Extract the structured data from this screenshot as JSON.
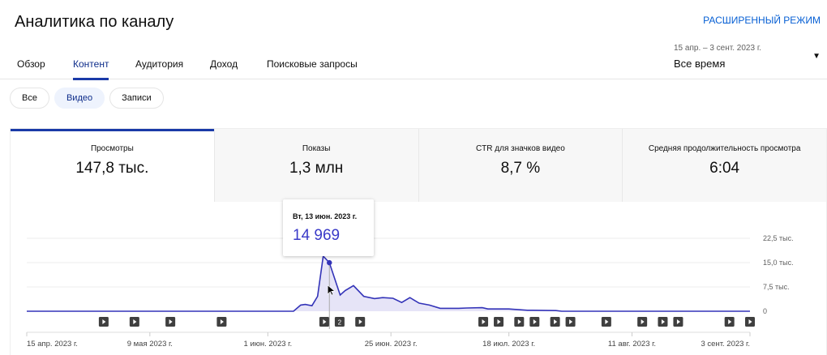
{
  "header": {
    "title": "Аналитика по каналу",
    "advanced_mode": "РАСШИРЕННЫЙ РЕЖИМ"
  },
  "tabs": [
    {
      "label": "Обзор"
    },
    {
      "label": "Контент",
      "active": true
    },
    {
      "label": "Аудитория"
    },
    {
      "label": "Доход"
    },
    {
      "label": "Поисковые запросы"
    }
  ],
  "date_range": {
    "range": "15 апр. – 3 сент. 2023 г.",
    "selected": "Все время"
  },
  "filters": [
    {
      "label": "Все"
    },
    {
      "label": "Видео",
      "active": true
    },
    {
      "label": "Записи"
    }
  ],
  "metrics": [
    {
      "label": "Просмотры",
      "value": "147,8 тыс.",
      "active": true
    },
    {
      "label": "Показы",
      "value": "1,3 млн"
    },
    {
      "label": "CTR для значков видео",
      "value": "8,7 %"
    },
    {
      "label": "Средняя продолжительность просмотра",
      "value": "6:04"
    }
  ],
  "tooltip": {
    "date": "Вт, 13 июн. 2023 г.",
    "value": "14 969"
  },
  "chart_data": {
    "type": "area",
    "title": "Просмотры",
    "x_unit": "days since 15 апр. 2023",
    "xlim": [
      0,
      141
    ],
    "ylim": [
      0,
      22500
    ],
    "y_ticks": [
      {
        "v": 22500,
        "label": "22,5 тыс."
      },
      {
        "v": 15000,
        "label": "15,0 тыс."
      },
      {
        "v": 7500,
        "label": "7,5 тыс."
      },
      {
        "v": 0,
        "label": "0"
      }
    ],
    "x_ticks": [
      {
        "d": 0,
        "label": "15 апр. 2023 г."
      },
      {
        "d": 24,
        "label": "9 мая 2023 г."
      },
      {
        "d": 47,
        "label": "1 июн. 2023 г."
      },
      {
        "d": 71,
        "label": "25 июн. 2023 г."
      },
      {
        "d": 94,
        "label": "18 июл. 2023 г."
      },
      {
        "d": 118,
        "label": "11 авг. 2023 г."
      },
      {
        "d": 141,
        "label": "3 сент. 2023 г."
      }
    ],
    "points": [
      [
        0,
        0
      ],
      [
        52,
        0
      ],
      [
        53.4,
        1900
      ],
      [
        54.3,
        2100
      ],
      [
        55.6,
        1700
      ],
      [
        56.7,
        4600
      ],
      [
        57.8,
        17000
      ],
      [
        59,
        14969
      ],
      [
        61.1,
        5000
      ],
      [
        62.1,
        6400
      ],
      [
        63.7,
        7900
      ],
      [
        65.7,
        4600
      ],
      [
        67.8,
        3900
      ],
      [
        69.4,
        4200
      ],
      [
        71.4,
        4000
      ],
      [
        73.1,
        2700
      ],
      [
        74.7,
        4200
      ],
      [
        76.5,
        2500
      ],
      [
        78.5,
        1900
      ],
      [
        80.6,
        900
      ],
      [
        84.2,
        900
      ],
      [
        85.8,
        1000
      ],
      [
        88.8,
        1100
      ],
      [
        89.9,
        700
      ],
      [
        94,
        700
      ],
      [
        97.6,
        300
      ],
      [
        98.6,
        300
      ],
      [
        103.2,
        200
      ],
      [
        104.3,
        0
      ],
      [
        141,
        0
      ]
    ],
    "highlight_day": 59,
    "video_markers": [
      {
        "d": 15
      },
      {
        "d": 21
      },
      {
        "d": 28
      },
      {
        "d": 38
      },
      {
        "d": 58
      },
      {
        "d": 61,
        "count": "2"
      },
      {
        "d": 65
      },
      {
        "d": 89
      },
      {
        "d": 92
      },
      {
        "d": 96
      },
      {
        "d": 99
      },
      {
        "d": 103
      },
      {
        "d": 106
      },
      {
        "d": 113
      },
      {
        "d": 120
      },
      {
        "d": 124
      },
      {
        "d": 127
      },
      {
        "d": 137
      },
      {
        "d": 141
      }
    ],
    "colors": {
      "line": "#3333b8",
      "fill": "#e6e4f7",
      "marker": "#3f3f3f"
    }
  }
}
